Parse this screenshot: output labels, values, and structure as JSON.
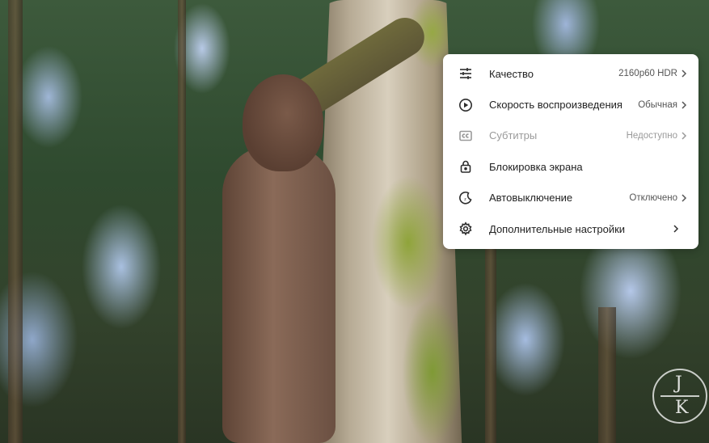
{
  "menu": {
    "items": [
      {
        "label": "Качество",
        "value": "2160p60 HDR",
        "icon": "sliders-icon",
        "has_chevron": true,
        "disabled": false
      },
      {
        "label": "Скорость воспроизведения",
        "value": "Обычная",
        "icon": "playback-speed-icon",
        "has_chevron": true,
        "disabled": false
      },
      {
        "label": "Субтитры",
        "value": "Недоступно",
        "icon": "closed-captions-icon",
        "has_chevron": true,
        "disabled": true
      },
      {
        "label": "Блокировка экрана",
        "value": "",
        "icon": "lock-icon",
        "has_chevron": false,
        "disabled": false
      },
      {
        "label": "Автовыключение",
        "value": "Отключено",
        "icon": "sleep-timer-icon",
        "has_chevron": true,
        "disabled": false
      },
      {
        "label": "Дополнительные настройки",
        "value": "",
        "icon": "gear-icon",
        "has_chevron": true,
        "disabled": false
      }
    ]
  },
  "watermark": {
    "letter_top": "J",
    "letter_bottom": "K"
  },
  "colors": {
    "menu_bg": "#ffffff",
    "text": "#222222",
    "disabled_text": "#9a9a9a"
  }
}
